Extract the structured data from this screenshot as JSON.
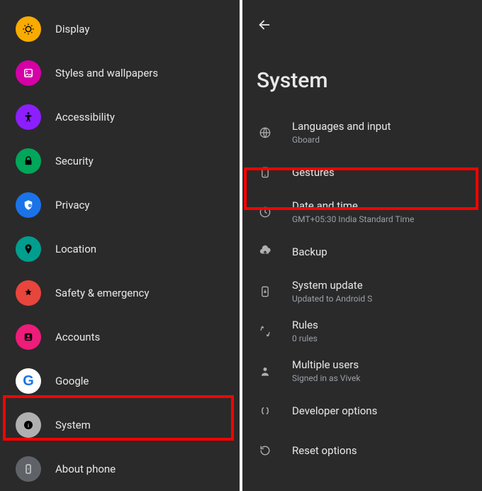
{
  "left": {
    "items": [
      {
        "label": "Display",
        "icon": "display-icon",
        "bg": "bg-orange"
      },
      {
        "label": "Styles and wallpapers",
        "icon": "wallpaper-icon",
        "bg": "bg-magenta"
      },
      {
        "label": "Accessibility",
        "icon": "accessibility-icon",
        "bg": "bg-purple"
      },
      {
        "label": "Security",
        "icon": "security-icon",
        "bg": "bg-green"
      },
      {
        "label": "Privacy",
        "icon": "privacy-icon",
        "bg": "bg-blue"
      },
      {
        "label": "Location",
        "icon": "location-icon",
        "bg": "bg-teal"
      },
      {
        "label": "Safety & emergency",
        "icon": "safety-icon",
        "bg": "bg-red"
      },
      {
        "label": "Accounts",
        "icon": "accounts-icon",
        "bg": "bg-pink"
      },
      {
        "label": "Google",
        "icon": "google-icon",
        "bg": "bg-white"
      },
      {
        "label": "System",
        "icon": "system-icon",
        "bg": "bg-grey"
      },
      {
        "label": "About phone",
        "icon": "about-icon",
        "bg": "bg-dkgrey"
      }
    ]
  },
  "right": {
    "title": "System",
    "items": [
      {
        "label": "Languages and input",
        "sub": "Gboard",
        "icon": "language-icon"
      },
      {
        "label": "Gestures",
        "sub": "",
        "icon": "gesture-icon"
      },
      {
        "label": "Date and time",
        "sub": "GMT+05:30 India Standard Time",
        "icon": "clock-icon"
      },
      {
        "label": "Backup",
        "sub": "",
        "icon": "backup-icon"
      },
      {
        "label": "System update",
        "sub": "Updated to Android S",
        "icon": "update-icon"
      },
      {
        "label": "Rules",
        "sub": "0 rules",
        "icon": "rules-icon"
      },
      {
        "label": "Multiple users",
        "sub": "Signed in as Vivek",
        "icon": "user-icon"
      },
      {
        "label": "Developer options",
        "sub": "",
        "icon": "dev-icon"
      },
      {
        "label": "Reset options",
        "sub": "",
        "icon": "reset-icon"
      }
    ]
  }
}
